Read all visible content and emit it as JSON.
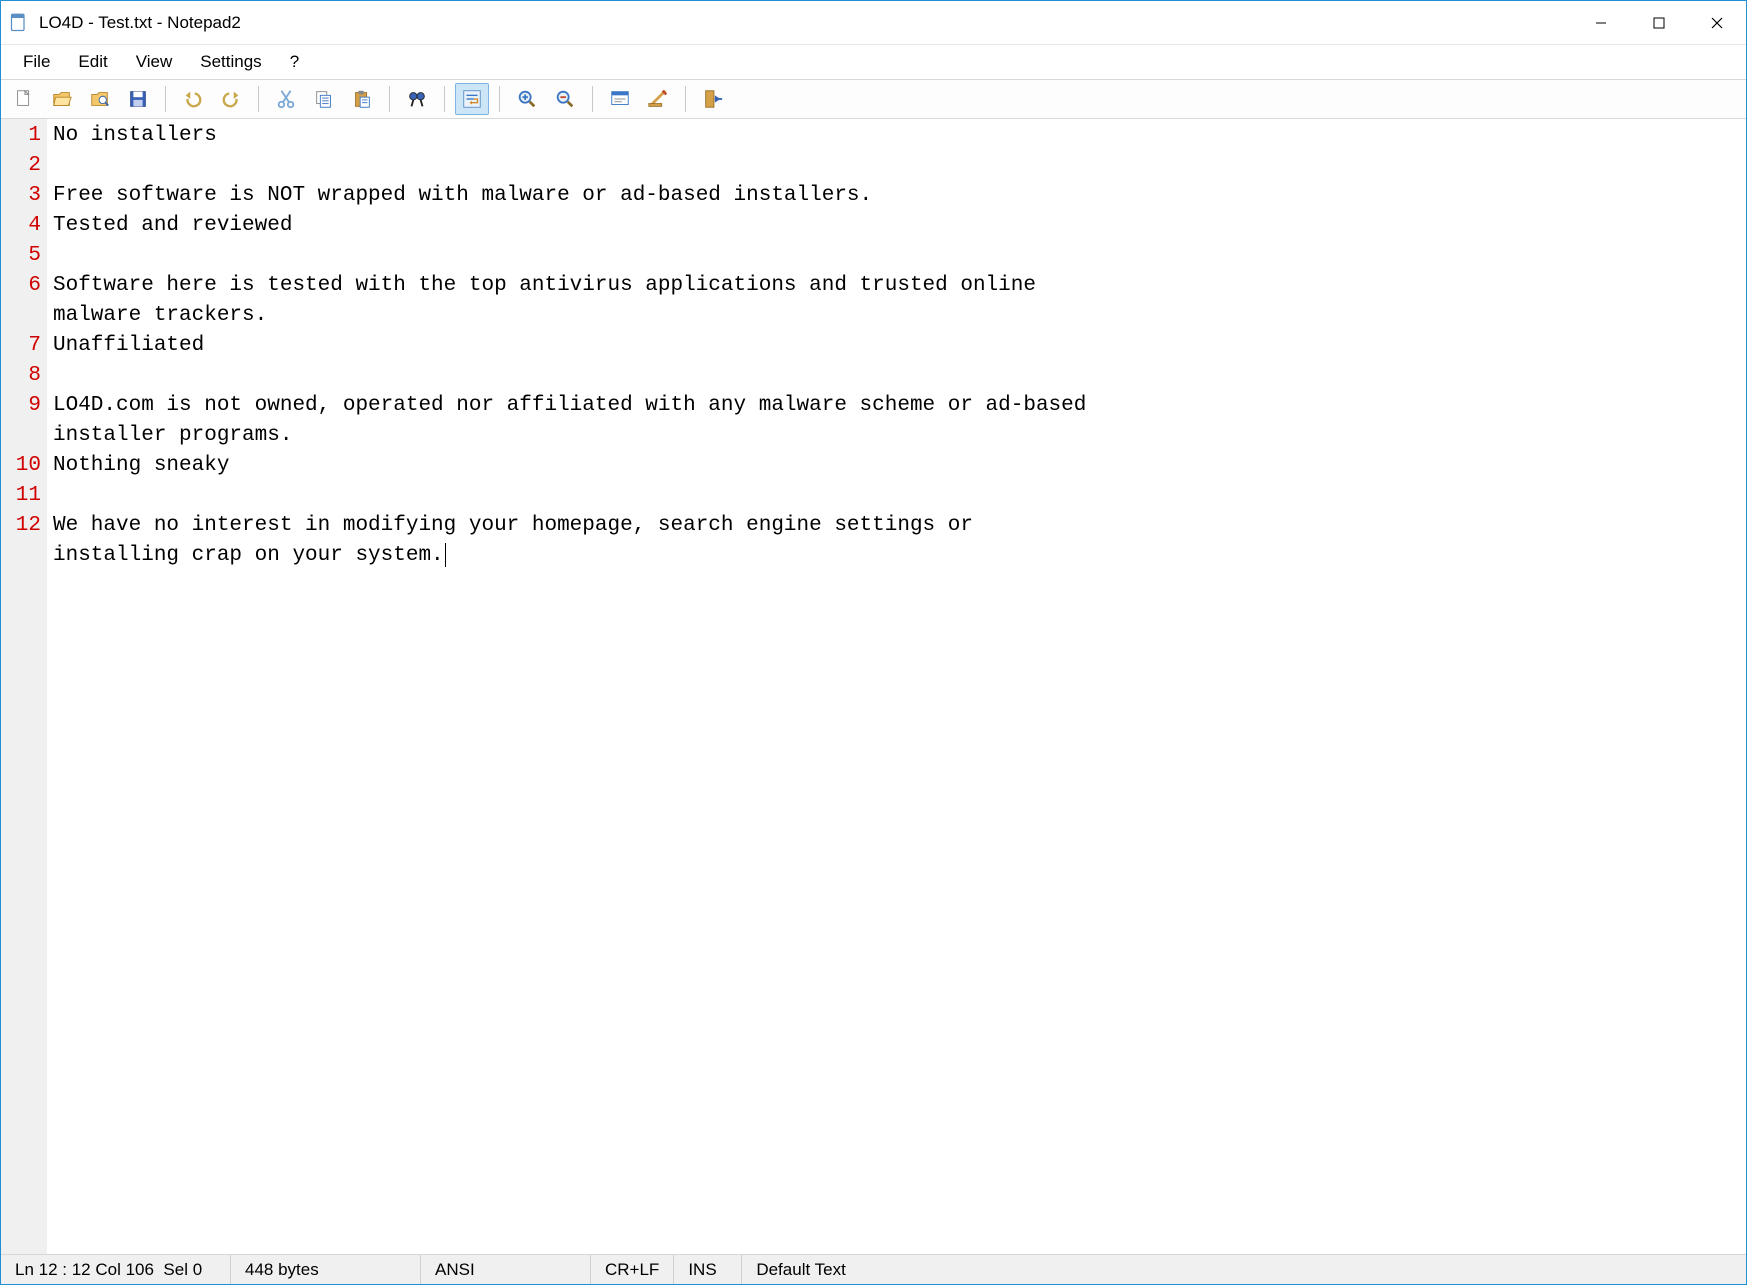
{
  "window": {
    "title": "LO4D - Test.txt - Notepad2"
  },
  "menu": {
    "items": [
      "File",
      "Edit",
      "View",
      "Settings",
      "?"
    ]
  },
  "toolbar": {
    "buttons": [
      {
        "name": "new-file-icon"
      },
      {
        "name": "open-file-icon"
      },
      {
        "name": "browse-icon"
      },
      {
        "name": "save-icon"
      },
      {
        "sep": true
      },
      {
        "name": "undo-icon"
      },
      {
        "name": "redo-icon"
      },
      {
        "sep": true
      },
      {
        "name": "cut-icon"
      },
      {
        "name": "copy-icon"
      },
      {
        "name": "paste-icon"
      },
      {
        "sep": true
      },
      {
        "name": "find-icon"
      },
      {
        "sep": true
      },
      {
        "name": "word-wrap-icon",
        "active": true
      },
      {
        "sep": true
      },
      {
        "name": "zoom-in-icon"
      },
      {
        "name": "zoom-out-icon"
      },
      {
        "sep": true
      },
      {
        "name": "scheme-icon"
      },
      {
        "name": "customize-icon"
      },
      {
        "sep": true
      },
      {
        "name": "exit-icon"
      }
    ]
  },
  "editor": {
    "lines": [
      {
        "num": 1,
        "text": "No installers"
      },
      {
        "num": 2,
        "text": ""
      },
      {
        "num": 3,
        "text": "Free software is NOT wrapped with malware or ad-based installers."
      },
      {
        "num": 4,
        "text": "Tested and reviewed"
      },
      {
        "num": 5,
        "text": ""
      },
      {
        "num": 6,
        "text": "Software here is tested with the top antivirus applications and trusted online malware trackers."
      },
      {
        "num": 7,
        "text": "Unaffiliated"
      },
      {
        "num": 8,
        "text": ""
      },
      {
        "num": 9,
        "text": "LO4D.com is not owned, operated nor affiliated with any malware scheme or ad-based installer programs."
      },
      {
        "num": 10,
        "text": "Nothing sneaky"
      },
      {
        "num": 11,
        "text": ""
      },
      {
        "num": 12,
        "text": "We have no interest in modifying your homepage, search engine settings or installing crap on your system."
      }
    ],
    "wrap_width_chars": 82
  },
  "status": {
    "position": "Ln 12 : 12  Col 106",
    "selection": "Sel 0",
    "size": "448 bytes",
    "encoding": "ANSI",
    "eol": "CR+LF",
    "mode": "INS",
    "scheme": "Default Text"
  }
}
